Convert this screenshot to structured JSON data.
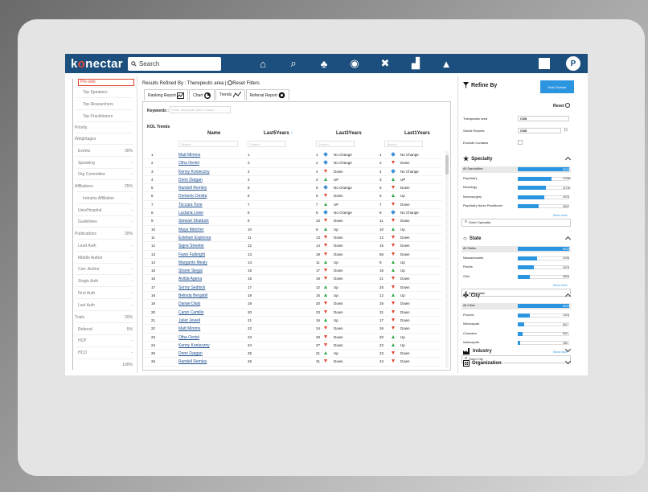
{
  "header": {
    "logo_a": "k",
    "logo_o": "o",
    "logo_b": "nectar",
    "search_placeholder": "Search",
    "avatar": "P",
    "nav": [
      {
        "icon": "home-icon",
        "glyph": "⌂"
      },
      {
        "icon": "search-user-icon",
        "glyph": "⌕"
      },
      {
        "icon": "people-icon",
        "glyph": "♣"
      },
      {
        "icon": "network-icon",
        "glyph": "◉"
      },
      {
        "icon": "cross-icon",
        "glyph": "✖"
      },
      {
        "icon": "chart-icon",
        "glyph": "▟"
      },
      {
        "icon": "bell-icon",
        "glyph": "▲"
      }
    ]
  },
  "sidebar": {
    "items": [
      {
        "label": "Pre-sets",
        "value": ""
      },
      {
        "label": "Top Speakers",
        "value": ""
      },
      {
        "label": "Top Researchers",
        "value": ""
      },
      {
        "label": "Top Practitioners",
        "value": ""
      },
      {
        "label": "Priority",
        "value": ""
      },
      {
        "label": "Weightages",
        "value": ""
      },
      {
        "label": "Events",
        "value": "30%"
      },
      {
        "label": "Speaking",
        "value": "-"
      },
      {
        "label": "Org Committee",
        "value": "-"
      },
      {
        "label": "Affiliations",
        "value": "25%"
      },
      {
        "label": "Industry Affiliation",
        "value": "-"
      },
      {
        "label": "Univ/Hospital",
        "value": "-"
      },
      {
        "label": "Guidelines",
        "value": "-"
      },
      {
        "label": "Publications",
        "value": "20%"
      },
      {
        "label": "Lead Auth",
        "value": "-"
      },
      {
        "label": "Middle Author",
        "value": "-"
      },
      {
        "label": "Corr. Author",
        "value": "-"
      },
      {
        "label": "Single Auth",
        "value": "-"
      },
      {
        "label": "First Auth",
        "value": "-"
      },
      {
        "label": "Last Auth",
        "value": "-"
      },
      {
        "label": "Trials",
        "value": "20%"
      },
      {
        "label": "Referral",
        "value": "5%"
      },
      {
        "label": "HCP",
        "value": "-"
      },
      {
        "label": "HCO",
        "value": "-"
      },
      {
        "label": "",
        "value": "100%"
      }
    ]
  },
  "content": {
    "results_text": "Results Refined By : Therepeutic area |",
    "reset_filters": "Reset Filters",
    "tabs": [
      "Ranking Report",
      "Chart",
      "Trends",
      "Referral Report"
    ],
    "keywords_label": "Keywords :",
    "keywords_placeholder": "Enter Keywords (Min 3 chars)",
    "kol_trends": "KOL Trends",
    "columns": {
      "name": "Name",
      "last5": "Last5Years",
      "last3": "Last3Years",
      "last1": "Last1Years",
      "sort": "↑"
    },
    "search_placeholder": "Search",
    "rows": [
      {
        "rank": "1",
        "name": "Matt Mimms",
        "l5": "1",
        "l3": "1",
        "l3s": "No Change",
        "l1": "1",
        "l1s": "No Change"
      },
      {
        "rank": "2",
        "name": "Otha Oertel",
        "l5": "2",
        "l3": "2",
        "l3s": "No Change",
        "l1": "2",
        "l1s": "Down"
      },
      {
        "rank": "3",
        "name": "Kenny Konieczny",
        "l5": "3",
        "l3": "4",
        "l3s": "Down",
        "l1": "4",
        "l1s": "No Change"
      },
      {
        "rank": "4",
        "name": "Donn Dargan",
        "l5": "4",
        "l3": "3",
        "l3s": "UP",
        "l1": "3",
        "l1s": "UP"
      },
      {
        "rank": "5",
        "name": "Randell Remley",
        "l5": "5",
        "l3": "5",
        "l3s": "No Change",
        "l1": "6",
        "l1s": "Down"
      },
      {
        "rank": "6",
        "name": "Domenic Devita",
        "l5": "6",
        "l3": "6",
        "l3s": "Down",
        "l1": "5",
        "l1s": "Up"
      },
      {
        "rank": "7",
        "name": "Toccara Tone",
        "l5": "7",
        "l3": "7",
        "l3s": "UP",
        "l1": "7",
        "l1s": "Down"
      },
      {
        "rank": "8",
        "name": "Luciana Lowe",
        "l5": "8",
        "l3": "8",
        "l3s": "No Change",
        "l1": "8",
        "l1s": "No Change"
      },
      {
        "rank": "9",
        "name": "Stewart Shattuck",
        "l5": "9",
        "l3": "10",
        "l3s": "Down",
        "l1": "11",
        "l1s": "Down"
      },
      {
        "rank": "10",
        "name": "Maya Melcher",
        "l5": "10",
        "l3": "9",
        "l3s": "Up",
        "l1": "10",
        "l1s": "Up"
      },
      {
        "rank": "11",
        "name": "Esteban Espinosa",
        "l5": "11",
        "l3": "13",
        "l3s": "Down",
        "l1": "12",
        "l1s": "Down"
      },
      {
        "rank": "12",
        "name": "Signe Streeter",
        "l5": "12",
        "l3": "14",
        "l3s": "Down",
        "l1": "15",
        "l1s": "Down"
      },
      {
        "rank": "13",
        "name": "Fawn Fulbright",
        "l5": "13",
        "l3": "19",
        "l3s": "Down",
        "l1": "56",
        "l1s": "Down"
      },
      {
        "rank": "14",
        "name": "Margarito Mealy",
        "l5": "14",
        "l3": "11",
        "l3s": "Up",
        "l1": "9",
        "l1s": "Up"
      },
      {
        "rank": "15",
        "name": "Shane Siegal",
        "l5": "15",
        "l3": "17",
        "l3s": "Down",
        "l1": "16",
        "l1s": "Up"
      },
      {
        "rank": "16",
        "name": "Avilda Agena",
        "l5": "16",
        "l3": "18",
        "l3s": "Down",
        "l1": "21",
        "l1s": "Down"
      },
      {
        "rank": "17",
        "name": "Sonny Sedlock",
        "l5": "17",
        "l3": "12",
        "l3s": "Up",
        "l1": "25",
        "l1s": "Down"
      },
      {
        "rank": "18",
        "name": "Belinda Bergdoll",
        "l5": "18",
        "l3": "15",
        "l3s": "Up",
        "l1": "12",
        "l1s": "Up"
      },
      {
        "rank": "19",
        "name": "Danae Dials",
        "l5": "19",
        "l3": "20",
        "l3s": "Down",
        "l1": "28",
        "l1s": "Down"
      },
      {
        "rank": "20",
        "name": "Caryn Camillo",
        "l5": "20",
        "l3": "23",
        "l3s": "Down",
        "l1": "31",
        "l1s": "Down"
      },
      {
        "rank": "21",
        "name": "Juliet Jewell",
        "l5": "21",
        "l3": "16",
        "l3s": "Up",
        "l1": "17",
        "l1s": "Down"
      },
      {
        "rank": "22",
        "name": "Matt Mimms",
        "l5": "22",
        "l3": "24",
        "l3s": "Down",
        "l1": "26",
        "l1s": "Down"
      },
      {
        "rank": "23",
        "name": "Otha Oertel",
        "l5": "23",
        "l3": "29",
        "l3s": "Down",
        "l1": "20",
        "l1s": "Up"
      },
      {
        "rank": "24",
        "name": "Kenny Konieczny",
        "l5": "24",
        "l3": "27",
        "l3s": "Down",
        "l1": "22",
        "l1s": "Up"
      },
      {
        "rank": "25",
        "name": "Donn Dargan",
        "l5": "25",
        "l3": "21",
        "l3s": "Up",
        "l1": "23",
        "l1s": "Down"
      },
      {
        "rank": "26",
        "name": "Randell Remley",
        "l5": "26",
        "l3": "31",
        "l3s": "Down",
        "l1": "43",
        "l1s": "Down"
      }
    ]
  },
  "refine": {
    "title": "Refine By",
    "hide_sidebar": "Hide Sidebar",
    "reset": "Reset",
    "therapeutic_label": "Therapeutic area",
    "therapeutic_value": "CNS",
    "saved_label": "Saved Reports",
    "saved_value": "CNS",
    "exclude_label": "Exclude Contacts",
    "show_more": "Show more",
    "specialty": {
      "title": "Specialty",
      "enter": "Enter Specialty",
      "items": [
        {
          "label": "All Specialities",
          "value": "50227",
          "pct": 1
        },
        {
          "label": "Psychiatry",
          "value": "24305",
          "pct": 0.66
        },
        {
          "label": "Neurology",
          "value": "11710",
          "pct": 0.55
        },
        {
          "label": "Neurosurgery",
          "value": "4023",
          "pct": 0.52
        },
        {
          "label": "Psychiatry Nurse Practitioner",
          "value": "3837",
          "pct": 0.41
        }
      ]
    },
    "state": {
      "title": "State",
      "enter": "Enter State",
      "items": [
        {
          "label": "All States",
          "value": "50227",
          "pct": 1
        },
        {
          "label": "Massachusetts",
          "value": "3100",
          "pct": 0.38
        },
        {
          "label": "Florida",
          "value": "2979",
          "pct": 0.32
        },
        {
          "label": "Ohio",
          "value": "2803",
          "pct": 0.24
        }
      ]
    },
    "city": {
      "title": "City",
      "enter": "Enter City",
      "items": [
        {
          "label": "All Cities",
          "value": "50227",
          "pct": 1
        },
        {
          "label": "Phoenix",
          "value": "1424",
          "pct": 0.23
        },
        {
          "label": "Minneapolis",
          "value": "852",
          "pct": 0.13
        },
        {
          "label": "Columbus",
          "value": "800",
          "pct": 0.09
        },
        {
          "label": "Indianapolis",
          "value": "355",
          "pct": 0.05
        }
      ]
    },
    "industry": "Industry",
    "organization": "Organization"
  }
}
